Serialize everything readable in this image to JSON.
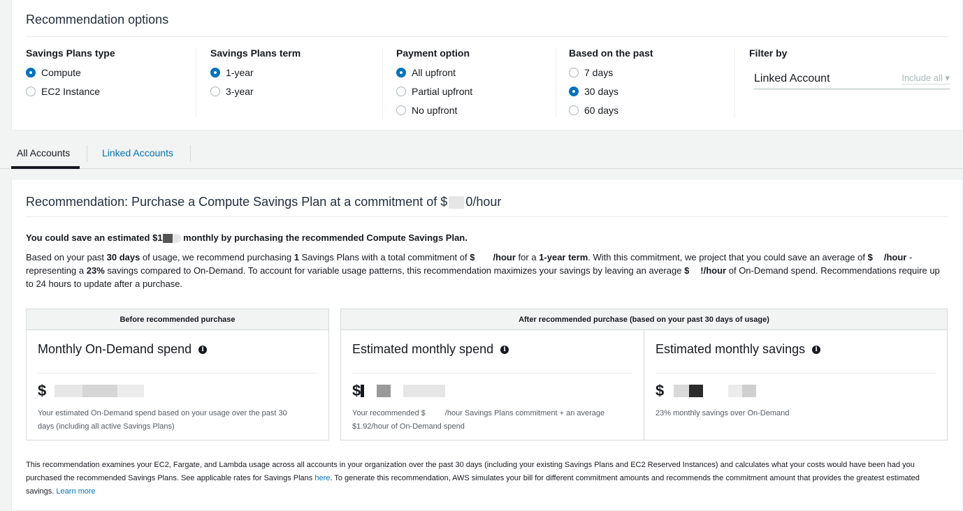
{
  "options": {
    "title": "Recommendation options",
    "plan_type": {
      "title": "Savings Plans type",
      "items": [
        "Compute",
        "EC2 Instance"
      ],
      "selected": "Compute"
    },
    "plan_term": {
      "title": "Savings Plans term",
      "items": [
        "1-year",
        "3-year"
      ],
      "selected": "1-year"
    },
    "payment": {
      "title": "Payment option",
      "items": [
        "All upfront",
        "Partial upfront",
        "No upfront"
      ],
      "selected": "All upfront"
    },
    "past": {
      "title": "Based on the past",
      "items": [
        "7 days",
        "30 days",
        "60 days"
      ],
      "selected": "30 days"
    },
    "filter": {
      "title": "Filter by",
      "label": "Linked Account",
      "select": "Include all ▾"
    }
  },
  "tabs": {
    "all": "All Accounts",
    "linked": "Linked Accounts"
  },
  "recommendation": {
    "title_a": "Recommendation: Purchase a Compute Savings Plan at a commitment of $",
    "title_b": "0/hour",
    "save_a": "You could save an estimated $1",
    "save_b": " monthly by purchasing the recommended Compute Savings Plan.",
    "desc_1": "Based on your past ",
    "desc_2": "30 days",
    "desc_3": " of usage, we recommend purchasing ",
    "desc_4": "1",
    "desc_5": " Savings Plans with a total commitment of ",
    "desc_6": "$",
    "desc_7": "/hour",
    "desc_8": " for a ",
    "desc_9": "1-year term",
    "desc_10": ". With this commitment, we project that you could save an average of ",
    "desc_11": "$",
    "desc_12": "/hour",
    "desc_13": " - representing a ",
    "desc_14": "23%",
    "desc_15": " savings compared to On-Demand. To account for variable usage patterns, this recommendation maximizes your savings by leaving an average ",
    "desc_16": "$",
    "desc_17": "!/hour",
    "desc_18": " of On-Demand spend. Recommendations require up to 24 hours to update after a purchase."
  },
  "cards": {
    "before_head": "Before recommended purchase",
    "after_head": "After recommended purchase (based on your past 30 days of usage)",
    "ondemand_title": "Monthly On-Demand spend",
    "ondemand_value": "$",
    "ondemand_note_1": "Your estimated On-Demand spend based on your usage over the past 30",
    "ondemand_note_2": "days (including all active Savings Plans)",
    "spend_title": "Estimated monthly spend",
    "spend_value": "$",
    "spend_note_a": "Your recommended $",
    "spend_note_b": "/hour Savings Plans commitment + an average",
    "spend_note_2": "$1.92/hour of On-Demand spend",
    "savings_title": "Estimated monthly savings",
    "savings_value": "$",
    "savings_note": "23% monthly savings over On-Demand"
  },
  "footer": {
    "text_a": "This recommendation examines your EC2, Fargate, and Lambda usage across all accounts in your organization over the past 30 days (including your existing Savings Plans and EC2 Reserved Instances) and calculates what your costs would have been had you purchased the recommended Savings Plans. See applicable rates for Savings Plans ",
    "here": "here",
    "text_b": ". To generate this recommendation, AWS simulates your bill for different commitment amounts and recommends the commitment amount that provides the greatest estimated savings. ",
    "learn_more": "Learn more"
  },
  "colors": {
    "accent": "#0073bb",
    "text": "#16191f",
    "border": "#d5dbdb"
  }
}
